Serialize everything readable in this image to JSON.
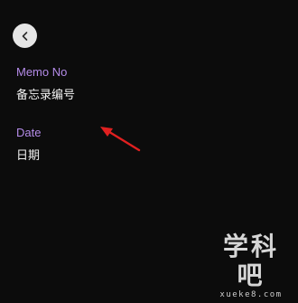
{
  "nav": {
    "back_icon": "chevron-left-icon"
  },
  "fields": {
    "memo_no": {
      "label": "Memo No",
      "value": "备忘录编号"
    },
    "date": {
      "label": "Date",
      "value": "日期"
    }
  },
  "annotation": {
    "icon": "red-arrow-icon"
  },
  "watermark": {
    "title": "学科吧",
    "url": "xueke8.com"
  },
  "colors": {
    "background": "#0c0c0c",
    "label": "#b48be8",
    "value": "#f2f2f2",
    "arrow": "#e02020"
  }
}
